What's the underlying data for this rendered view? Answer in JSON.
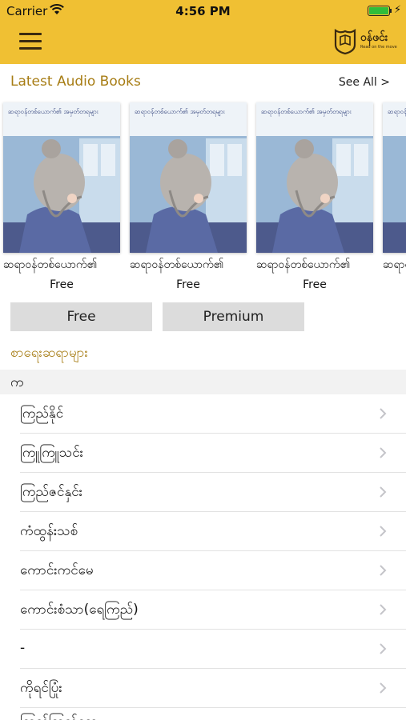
{
  "status": {
    "carrier": "Carrier",
    "time": "4:56 PM"
  },
  "app": {
    "logo_text": "ဝန်ဖင်း",
    "logo_sub": "Read on the move"
  },
  "audio_section": {
    "title": "Latest Audio Books",
    "see_all": "See All >"
  },
  "books": [
    {
      "cover_title": "ဆရာဝန်တစ်ယောက်၏ အမှတ်တရများ",
      "title": "ဆရာဝန်တစ်ယောက်၏",
      "price": "Free"
    },
    {
      "cover_title": "ဆရာဝန်တစ်ယောက်၏ အမှတ်တရများ",
      "title": "ဆရာဝန်တစ်ယောက်၏",
      "price": "Free"
    },
    {
      "cover_title": "ဆရာဝန်တစ်ယောက်၏ အမှတ်တရများ",
      "title": "ဆရာဝန်တစ်ယောက်၏",
      "price": "Free"
    },
    {
      "cover_title": "ဆရာဝန်တစ်ယောက်၏ အမှတ်တရများ",
      "title": "ဆရာဝန်တစ်ယောက်၏",
      "price": ""
    }
  ],
  "filters": {
    "free": "Free",
    "premium": "Premium"
  },
  "writers": {
    "title": "စာရေးဆရာများ",
    "group": "က",
    "items": [
      "ကြည်နိုင်",
      "ကြူကြူသင်း",
      "ကြည်ဇင်နှင်း",
      "ကံထွန်းသစ်",
      "ကောင်းကင်မေ",
      "ကောင်းစံသာ(ရေကြည်)",
      "-",
      "ကိုရင်ပြုံး",
      "ကြည်ကြည်ဆွေ"
    ]
  },
  "colors": {
    "header": "#f0c033",
    "accent": "#a77d15",
    "button": "#dcdcdc"
  }
}
